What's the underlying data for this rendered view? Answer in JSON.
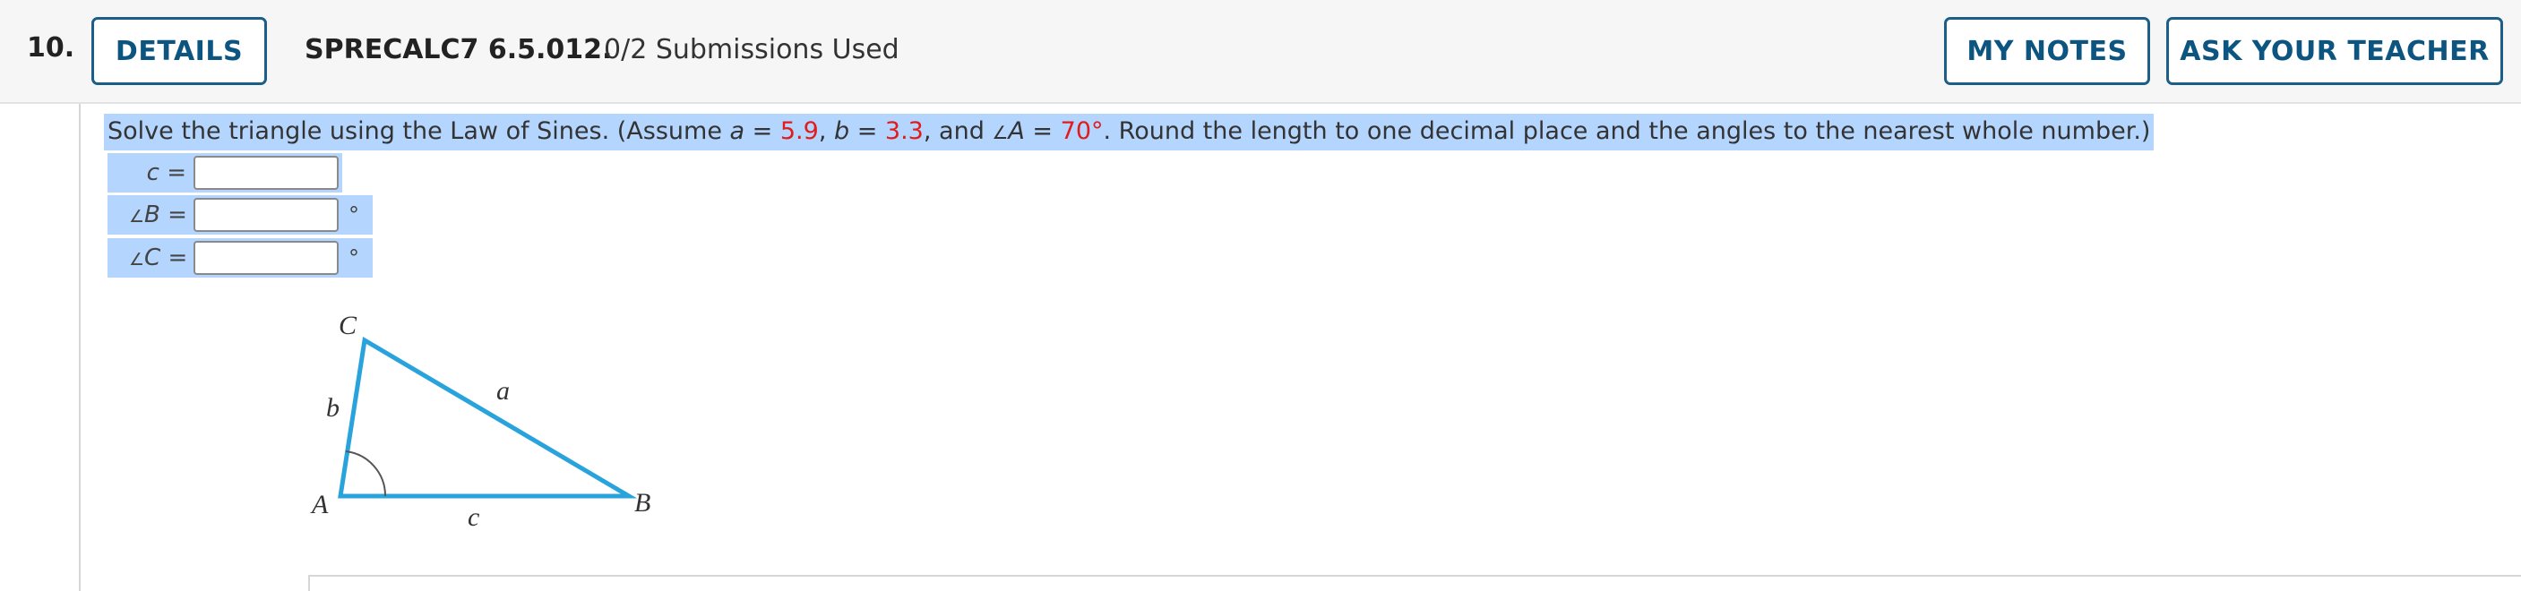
{
  "header": {
    "question_number": "10.",
    "details_label": "DETAILS",
    "question_code": "SPRECALC7 6.5.012.",
    "submissions": "0/2 Submissions Used",
    "my_notes_label": "MY NOTES",
    "ask_teacher_label": "ASK YOUR TEACHER"
  },
  "problem": {
    "intro": "Solve the triangle using the Law of Sines. (Assume ",
    "a_var": "a",
    "eq1": " = ",
    "a_val": "5.9",
    "sep1": ", ",
    "b_var": "b",
    "eq2": " = ",
    "b_val": "3.3",
    "sep2": ", and ",
    "angle_sym": "∠",
    "A_var": "A",
    "eq3": " = ",
    "A_val": "70°",
    "outro": ". Round the length to one decimal place and the angles to the nearest whole number.)"
  },
  "answers": [
    {
      "label_var": "c",
      "label_suffix": " =",
      "value": "",
      "unit": ""
    },
    {
      "label_var": "B",
      "label_prefix": "∠",
      "label_suffix": " =",
      "value": "",
      "unit": "°"
    },
    {
      "label_var": "C",
      "label_prefix": "∠",
      "label_suffix": " =",
      "value": "",
      "unit": "°"
    }
  ],
  "figure": {
    "vertex_A": "A",
    "vertex_B": "B",
    "vertex_C": "C",
    "side_a": "a",
    "side_b": "b",
    "side_c": "c",
    "line_color": "#29a3dc"
  }
}
